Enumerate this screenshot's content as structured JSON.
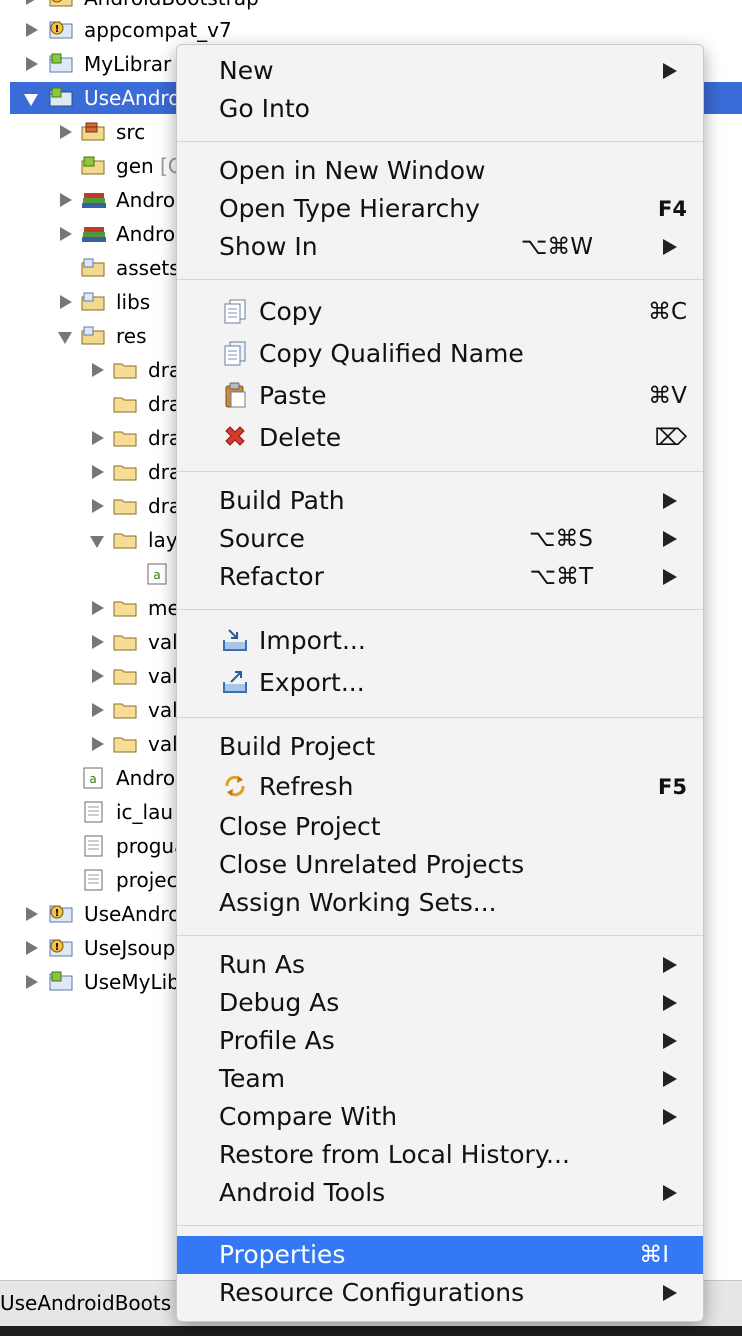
{
  "tree": {
    "rows": [
      {
        "label": "AndroidBootstrap",
        "decor": ""
      },
      {
        "label": "appcompat_v7",
        "decor": ""
      },
      {
        "label": "MyLibrar",
        "decor": ""
      },
      {
        "label": "UseAndro",
        "decor": ""
      },
      {
        "label": "src",
        "decor": ""
      },
      {
        "label": "gen",
        "decor": "[G"
      },
      {
        "label": "Androi",
        "decor": ""
      },
      {
        "label": "Androi",
        "decor": ""
      },
      {
        "label": "assets",
        "decor": ""
      },
      {
        "label": "libs",
        "decor": ""
      },
      {
        "label": "res",
        "decor": ""
      },
      {
        "label": "dra",
        "decor": ""
      },
      {
        "label": "dra",
        "decor": ""
      },
      {
        "label": "dra",
        "decor": ""
      },
      {
        "label": "dra",
        "decor": ""
      },
      {
        "label": "dra",
        "decor": ""
      },
      {
        "label": "lay",
        "decor": ""
      },
      {
        "label": "",
        "decor": ""
      },
      {
        "label": "me",
        "decor": ""
      },
      {
        "label": "val",
        "decor": ""
      },
      {
        "label": "val",
        "decor": ""
      },
      {
        "label": "val",
        "decor": ""
      },
      {
        "label": "val",
        "decor": ""
      },
      {
        "label": "Andro",
        "decor": ""
      },
      {
        "label": "ic_lau",
        "decor": ""
      },
      {
        "label": "progua",
        "decor": ""
      },
      {
        "label": "projec",
        "decor": ""
      },
      {
        "label": "UseAndro",
        "decor": ""
      },
      {
        "label": "UseJsoup",
        "decor": ""
      },
      {
        "label": "UseMyLib",
        "decor": ""
      }
    ]
  },
  "status_bar": {
    "text": "UseAndroidBoots"
  },
  "menu": {
    "items": [
      {
        "label": "New",
        "shortcut": "",
        "submenu": true,
        "icon": ""
      },
      {
        "label": "Go Into",
        "shortcut": "",
        "submenu": false,
        "icon": ""
      },
      {
        "label": "Open in New Window",
        "shortcut": "",
        "submenu": false,
        "icon": ""
      },
      {
        "label": "Open Type Hierarchy",
        "shortcut": "F4",
        "submenu": false,
        "icon": ""
      },
      {
        "label": "Show In",
        "shortcut": "⌥⌘W",
        "submenu": true,
        "icon": ""
      },
      {
        "label": "Copy",
        "shortcut": "⌘C",
        "submenu": false,
        "icon": "copy-icon"
      },
      {
        "label": "Copy Qualified Name",
        "shortcut": "",
        "submenu": false,
        "icon": "copy-qualified-name-icon"
      },
      {
        "label": "Paste",
        "shortcut": "⌘V",
        "submenu": false,
        "icon": "paste-icon"
      },
      {
        "label": "Delete",
        "shortcut": "⌦",
        "submenu": false,
        "icon": "delete-icon"
      },
      {
        "label": "Build Path",
        "shortcut": "",
        "submenu": true,
        "icon": ""
      },
      {
        "label": "Source",
        "shortcut": "⌥⌘S",
        "submenu": true,
        "icon": ""
      },
      {
        "label": "Refactor",
        "shortcut": "⌥⌘T",
        "submenu": true,
        "icon": ""
      },
      {
        "label": "Import...",
        "shortcut": "",
        "submenu": false,
        "icon": "import-icon"
      },
      {
        "label": "Export...",
        "shortcut": "",
        "submenu": false,
        "icon": "export-icon"
      },
      {
        "label": "Build Project",
        "shortcut": "",
        "submenu": false,
        "icon": ""
      },
      {
        "label": "Refresh",
        "shortcut": "F5",
        "submenu": false,
        "icon": "refresh-icon"
      },
      {
        "label": "Close Project",
        "shortcut": "",
        "submenu": false,
        "icon": ""
      },
      {
        "label": "Close Unrelated Projects",
        "shortcut": "",
        "submenu": false,
        "icon": ""
      },
      {
        "label": "Assign Working Sets...",
        "shortcut": "",
        "submenu": false,
        "icon": ""
      },
      {
        "label": "Run As",
        "shortcut": "",
        "submenu": true,
        "icon": ""
      },
      {
        "label": "Debug As",
        "shortcut": "",
        "submenu": true,
        "icon": ""
      },
      {
        "label": "Profile As",
        "shortcut": "",
        "submenu": true,
        "icon": ""
      },
      {
        "label": "Team",
        "shortcut": "",
        "submenu": true,
        "icon": ""
      },
      {
        "label": "Compare With",
        "shortcut": "",
        "submenu": true,
        "icon": ""
      },
      {
        "label": "Restore from Local History...",
        "shortcut": "",
        "submenu": false,
        "icon": ""
      },
      {
        "label": "Android Tools",
        "shortcut": "",
        "submenu": true,
        "icon": ""
      },
      {
        "label": "Properties",
        "shortcut": "⌘I",
        "submenu": false,
        "icon": "",
        "highlighted": true
      },
      {
        "label": "Resource Configurations",
        "shortcut": "",
        "submenu": true,
        "icon": ""
      }
    ]
  },
  "colors": {
    "selection": "#3b6bd6",
    "menu_highlight": "#3478f6",
    "menu_background": "#f3f3f3",
    "delete_red": "#d93a2b"
  }
}
